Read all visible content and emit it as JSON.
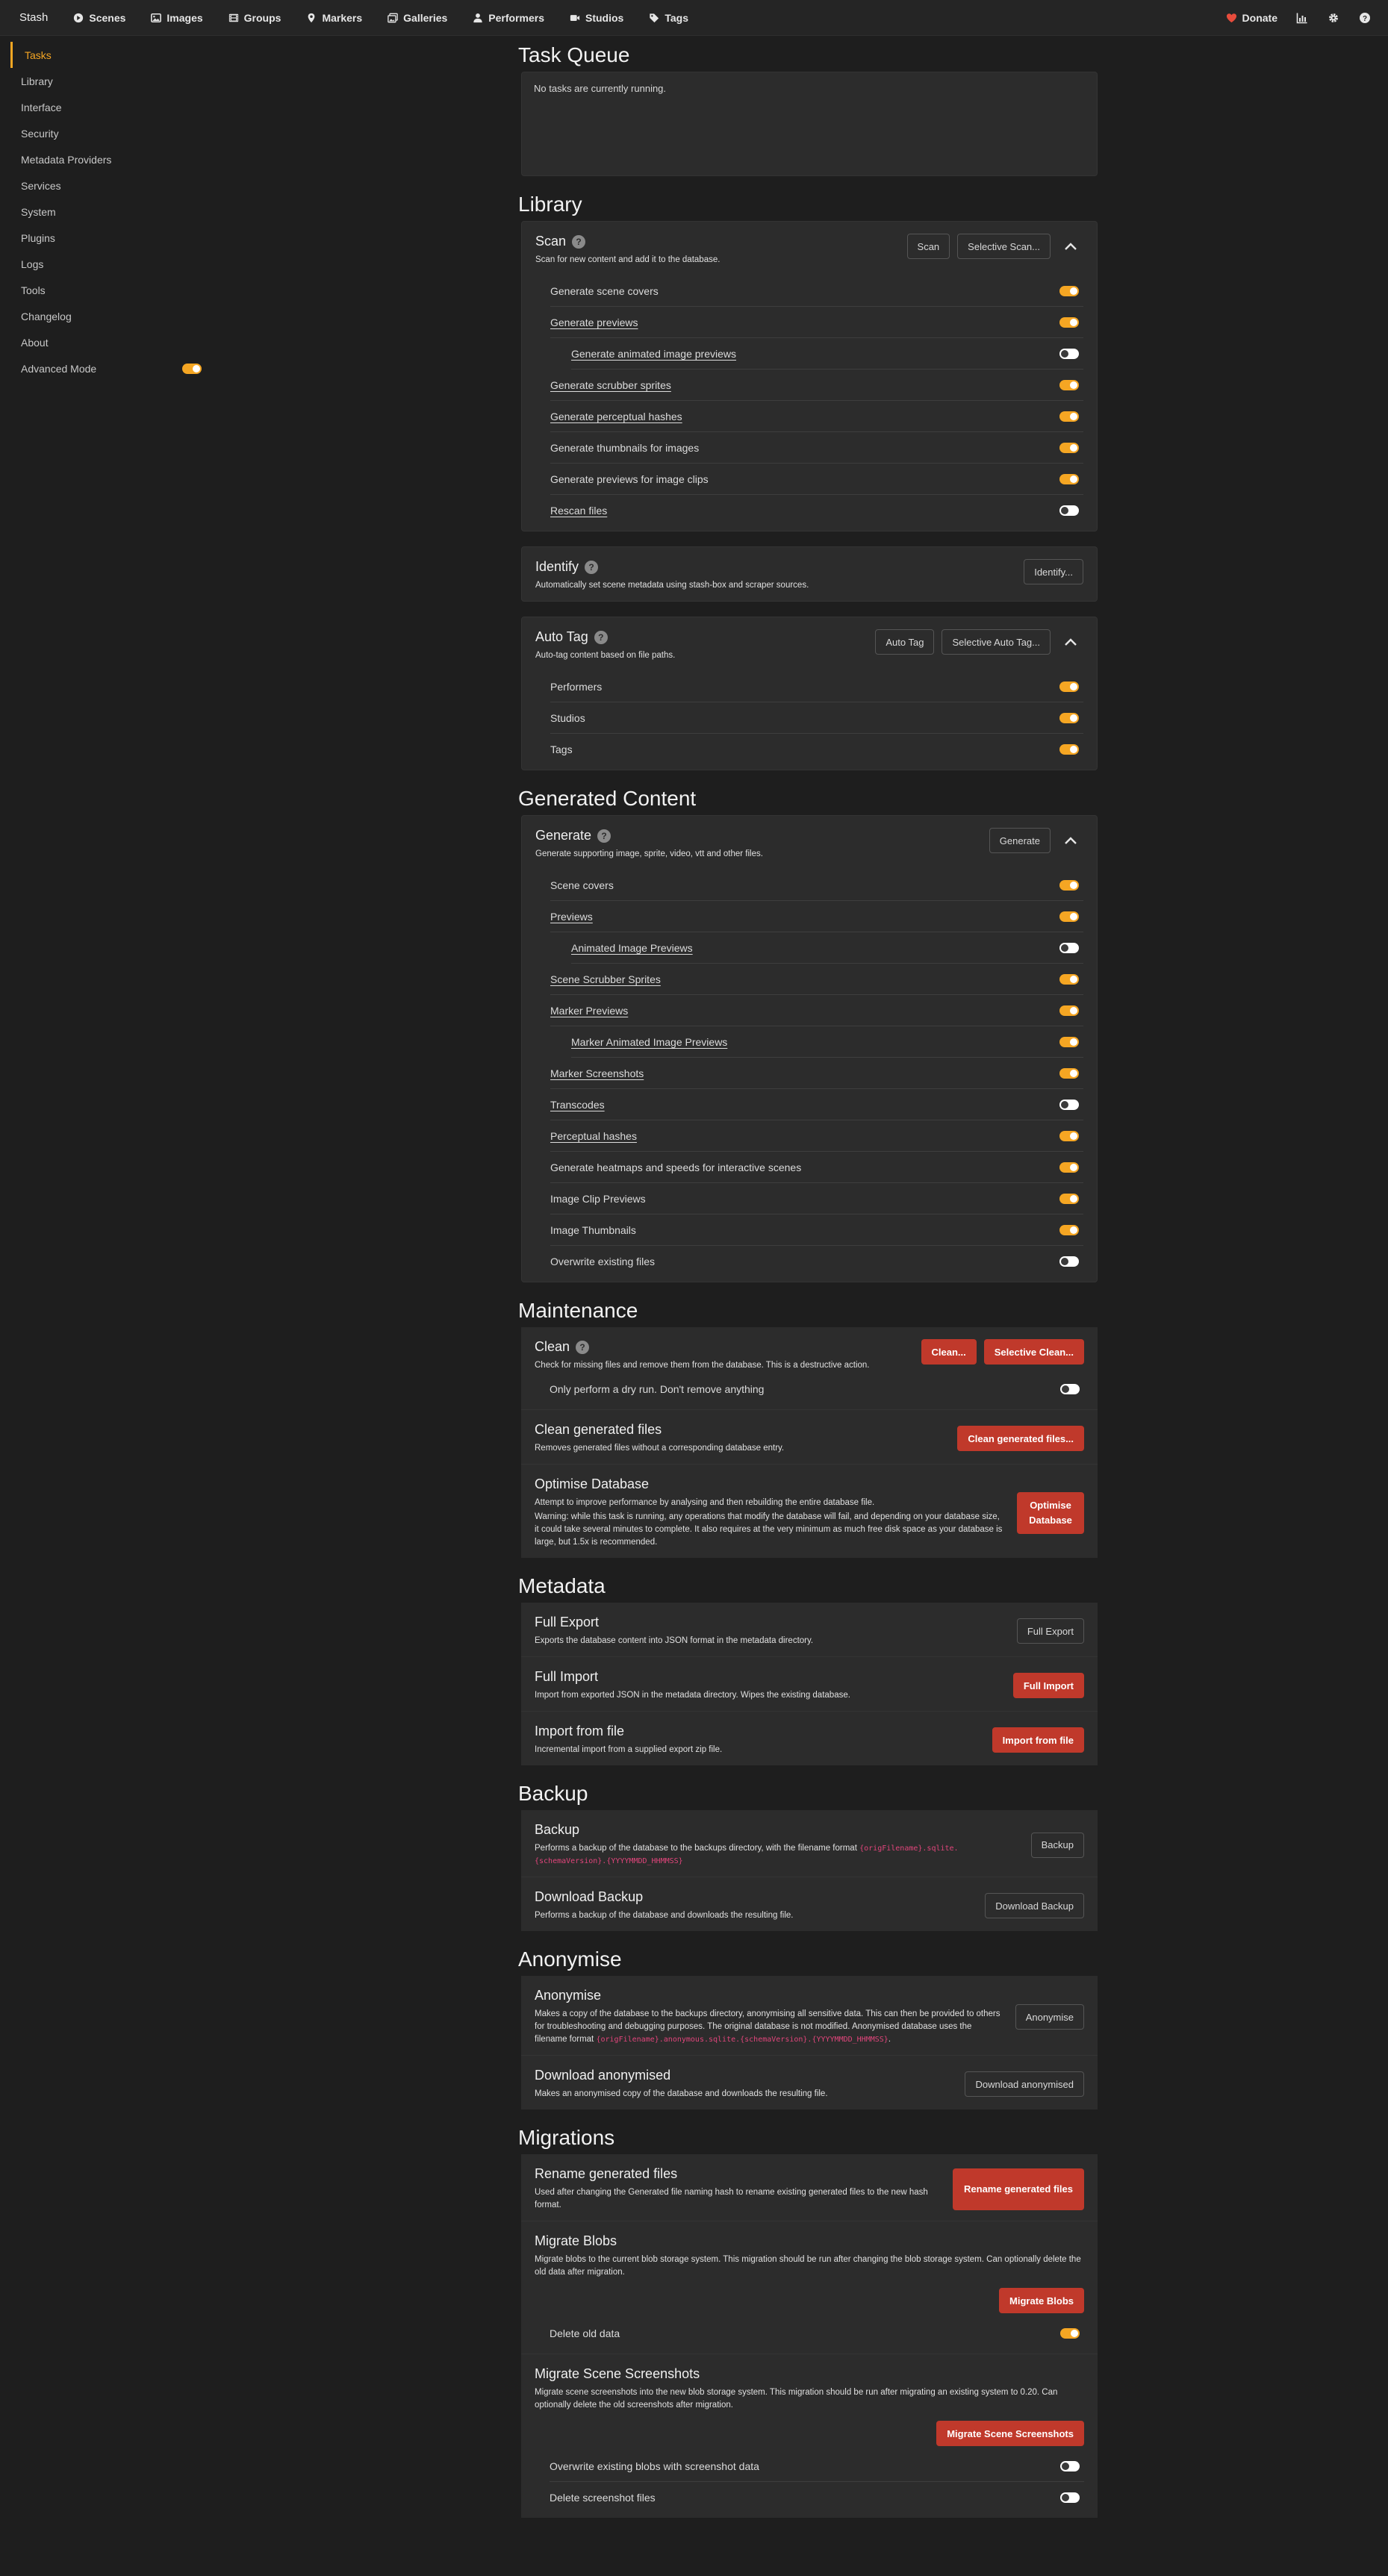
{
  "nav": {
    "brand": "Stash",
    "items": [
      {
        "id": "scenes",
        "label": "Scenes",
        "icon": "play-circle-icon"
      },
      {
        "id": "images",
        "label": "Images",
        "icon": "image-icon"
      },
      {
        "id": "groups",
        "label": "Groups",
        "icon": "film-icon"
      },
      {
        "id": "markers",
        "label": "Markers",
        "icon": "map-marker-icon"
      },
      {
        "id": "galleries",
        "label": "Galleries",
        "icon": "images-icon"
      },
      {
        "id": "performers",
        "label": "Performers",
        "icon": "user-icon"
      },
      {
        "id": "studios",
        "label": "Studios",
        "icon": "video-icon"
      },
      {
        "id": "tags",
        "label": "Tags",
        "icon": "tag-icon"
      }
    ],
    "donate": "Donate",
    "accent": "#f5a623",
    "heart_color": "#e74c3c"
  },
  "sidebar": {
    "items": [
      "Tasks",
      "Library",
      "Interface",
      "Security",
      "Metadata Providers",
      "Services",
      "System",
      "Plugins",
      "Logs",
      "Tools",
      "Changelog",
      "About"
    ],
    "advanced_mode": "Advanced Mode"
  },
  "task_queue": {
    "title": "Task Queue",
    "empty": "No tasks are currently running."
  },
  "library": {
    "title": "Library",
    "scan": {
      "title": "Scan",
      "desc": "Scan for new content and add it to the database.",
      "scan_btn": "Scan",
      "selective_btn": "Selective Scan...",
      "options": [
        {
          "label": "Generate scene covers"
        },
        {
          "label": "Generate previews"
        },
        {
          "label": "Generate animated image previews"
        },
        {
          "label": "Generate scrubber sprites"
        },
        {
          "label": "Generate perceptual hashes"
        },
        {
          "label": "Generate thumbnails for images"
        },
        {
          "label": "Generate previews for image clips"
        },
        {
          "label": "Rescan files"
        }
      ]
    },
    "identify": {
      "title": "Identify",
      "desc": "Automatically set scene metadata using stash-box and scraper sources.",
      "btn": "Identify..."
    },
    "autotag": {
      "title": "Auto Tag",
      "desc": "Auto-tag content based on file paths.",
      "btn": "Auto Tag",
      "selective_btn": "Selective Auto Tag...",
      "options": [
        {
          "label": "Performers"
        },
        {
          "label": "Studios"
        },
        {
          "label": "Tags"
        }
      ]
    }
  },
  "generated": {
    "title": "Generated Content",
    "generate": {
      "title": "Generate",
      "desc": "Generate supporting image, sprite, video, vtt and other files.",
      "btn": "Generate",
      "options": [
        {
          "label": "Scene covers"
        },
        {
          "label": "Previews"
        },
        {
          "label": "Animated Image Previews"
        },
        {
          "label": "Scene Scrubber Sprites"
        },
        {
          "label": "Marker Previews"
        },
        {
          "label": "Marker Animated Image Previews"
        },
        {
          "label": "Marker Screenshots"
        },
        {
          "label": "Transcodes"
        },
        {
          "label": "Perceptual hashes"
        },
        {
          "label": "Generate heatmaps and speeds for interactive scenes"
        },
        {
          "label": "Image Clip Previews"
        },
        {
          "label": "Image Thumbnails"
        },
        {
          "label": "Overwrite existing files"
        }
      ]
    }
  },
  "maintenance": {
    "title": "Maintenance",
    "clean": {
      "title": "Clean",
      "desc": "Check for missing files and remove them from the database. This is a destructive action.",
      "btn": "Clean...",
      "selective_btn": "Selective Clean...",
      "option": "Only perform a dry run. Don't remove anything"
    },
    "clean_generated": {
      "title": "Clean generated files",
      "desc": "Removes generated files without a corresponding database entry.",
      "btn": "Clean generated files..."
    },
    "optimise": {
      "title": "Optimise Database",
      "desc": "Attempt to improve performance by analysing and then rebuilding the entire database file.",
      "warning": "Warning: while this task is running, any operations that modify the database will fail, and depending on your database size, it could take several minutes to complete. It also requires at the very minimum as much free disk space as your database is large, but 1.5x is recommended.",
      "btn": "Optimise Database"
    }
  },
  "metadata": {
    "title": "Metadata",
    "full_export": {
      "title": "Full Export",
      "desc": "Exports the database content into JSON format in the metadata directory.",
      "btn": "Full Export"
    },
    "full_import": {
      "title": "Full Import",
      "desc": "Import from exported JSON in the metadata directory. Wipes the existing database.",
      "btn": "Full Import"
    },
    "import_file": {
      "title": "Import from file",
      "desc": "Incremental import from a supplied export zip file.",
      "btn": "Import from file"
    }
  },
  "backup": {
    "title": "Backup",
    "backup": {
      "title": "Backup",
      "desc": "Performs a backup of the database to the backups directory, with the filename format",
      "format": "{origFilename}.sqlite.{schemaVersion}.{YYYYMMDD_HHMMSS}",
      "suffix": "",
      "btn": "Backup"
    },
    "download": {
      "title": "Download Backup",
      "desc": "Performs a backup of the database and downloads the resulting file.",
      "btn": "Download Backup"
    }
  },
  "anonymise": {
    "title": "Anonymise",
    "anonymise": {
      "title": "Anonymise",
      "desc": "Makes a copy of the database to the backups directory, anonymising all sensitive data. This can then be provided to others for troubleshooting and debugging purposes. The original database is not modified. Anonymised database uses the filename format",
      "format": "{origFilename}.anonymous.sqlite.{schemaVersion}.{YYYYMMDD_HHMMSS}",
      "suffix": ".",
      "btn": "Anonymise"
    },
    "download": {
      "title": "Download anonymised",
      "desc": "Makes an anonymised copy of the database and downloads the resulting file.",
      "btn": "Download anonymised"
    }
  },
  "migrations": {
    "title": "Migrations",
    "rename": {
      "title": "Rename generated files",
      "desc": "Used after changing the Generated file naming hash to rename existing generated files to the new hash format.",
      "btn": "Rename generated files"
    },
    "blobs": {
      "title": "Migrate Blobs",
      "desc": "Migrate blobs to the current blob storage system. This migration should be run after changing the blob storage system. Can optionally delete the old data after migration.",
      "btn": "Migrate Blobs",
      "option": "Delete old data"
    },
    "screenshots": {
      "title": "Migrate Scene Screenshots",
      "desc": "Migrate scene screenshots into the new blob storage system. This migration should be run after migrating an existing system to 0.20. Can optionally delete the old screenshots after migration.",
      "btn": "Migrate Scene Screenshots",
      "options": [
        {
          "label": "Overwrite existing blobs with screenshot data"
        },
        {
          "label": "Delete screenshot files"
        }
      ]
    }
  }
}
